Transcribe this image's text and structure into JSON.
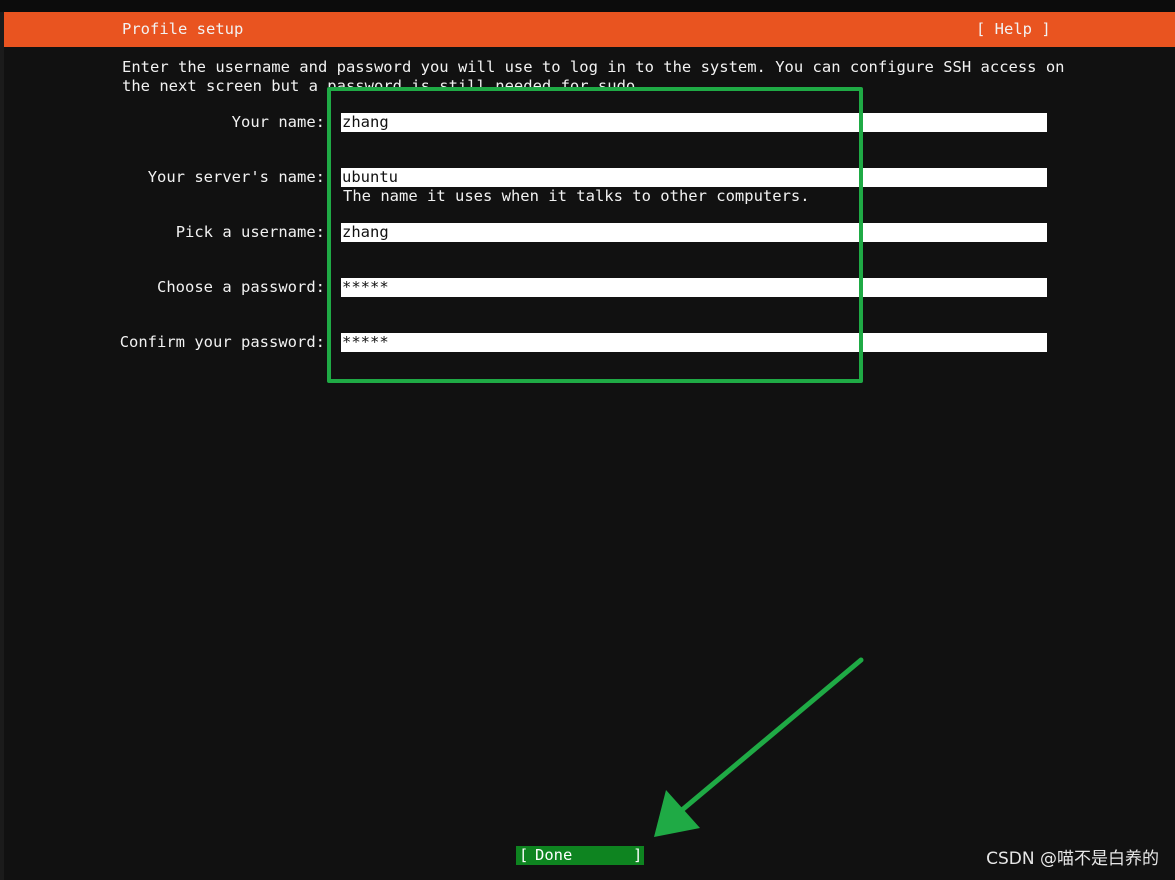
{
  "header": {
    "title": "Profile setup",
    "help_label": "[ Help ]",
    "background_color": "#e95420"
  },
  "intro": {
    "text": "Enter the username and password you will use to log in to the system. You can configure SSH access on\nthe next screen but a password is still needed for sudo."
  },
  "form": {
    "fields": [
      {
        "label": "Your name:",
        "value": "zhang"
      },
      {
        "label": "Your server's name:",
        "value": "ubuntu",
        "hint": "The name it uses when it talks to other computers."
      },
      {
        "label": "Pick a username:",
        "value": "zhang"
      },
      {
        "label": "Choose a password:",
        "value": "*****"
      },
      {
        "label": "Confirm your password:",
        "value": "*****"
      }
    ]
  },
  "done_button": {
    "bracket_left": "[",
    "label": "Done",
    "bracket_right": "]",
    "background_color": "#0e8420"
  },
  "annotation": {
    "highlight_color": "#1faa45",
    "arrow_color": "#1faa45"
  },
  "watermark": {
    "text": "CSDN @喵不是白养的"
  }
}
